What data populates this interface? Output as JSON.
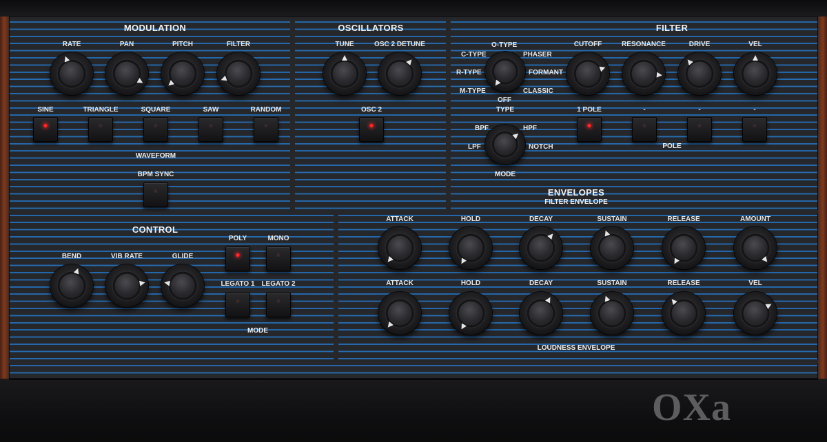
{
  "brand": "OXa",
  "modulation": {
    "title": "MODULATION",
    "knobs": [
      "RATE",
      "PAN",
      "PITCH",
      "FILTER"
    ],
    "waveforms": [
      {
        "label": "SINE",
        "active": true
      },
      {
        "label": "TRIANGLE",
        "active": false
      },
      {
        "label": "SQUARE",
        "active": false
      },
      {
        "label": "SAW",
        "active": false
      },
      {
        "label": "RANDOM",
        "active": false
      }
    ],
    "waveform_label": "WAVEFORM",
    "bpm_sync_label": "BPM SYNC"
  },
  "oscillators": {
    "title": "OSCILLATORS",
    "tune_label": "TUNE",
    "detune_label": "OSC 2 DETUNE",
    "osc2_label": "OSC 2"
  },
  "filter": {
    "title": "FILTER",
    "type_options": {
      "otype": "O-TYPE",
      "ctype": "C-TYPE",
      "phaser": "PHASER",
      "rtype": "R-TYPE",
      "formant": "FORMANT",
      "mtype": "M-TYPE",
      "classic": "CLASSIC",
      "off": "OFF"
    },
    "type_label": "TYPE",
    "knobs": [
      "CUTOFF",
      "RESONANCE",
      "DRIVE",
      "VEL"
    ],
    "poles": [
      "1 POLE",
      "-",
      "-",
      "-"
    ],
    "pole_label": "POLE",
    "mode_options": {
      "bpf": "BPF",
      "hpf": "HPF",
      "lpf": "LPF",
      "notch": "NOTCH"
    },
    "mode_label": "MODE"
  },
  "control": {
    "title": "CONTROL",
    "knobs": [
      "BEND",
      "VIB RATE",
      "GLIDE"
    ],
    "modes": [
      {
        "label": "POLY",
        "active": true
      },
      {
        "label": "MONO",
        "active": false
      },
      {
        "label": "LEGATO 1",
        "active": false
      },
      {
        "label": "LEGATO 2",
        "active": false
      }
    ],
    "mode_label": "MODE"
  },
  "envelopes": {
    "title": "ENVELOPES",
    "filter_env_label": "FILTER ENVELOPE",
    "filter_env": [
      "ATTACK",
      "HOLD",
      "DECAY",
      "SUSTAIN",
      "RELEASE",
      "AMOUNT"
    ],
    "loud_env": [
      "ATTACK",
      "HOLD",
      "DECAY",
      "SUSTAIN",
      "RELEASE",
      "VEL"
    ],
    "loud_env_label": "LOUDNESS ENVELOPE"
  },
  "colors": {
    "stripe": "#2a72b8",
    "panel": "#26272b",
    "led_on": "#ff2a2a",
    "wood": "#7a3a20"
  }
}
